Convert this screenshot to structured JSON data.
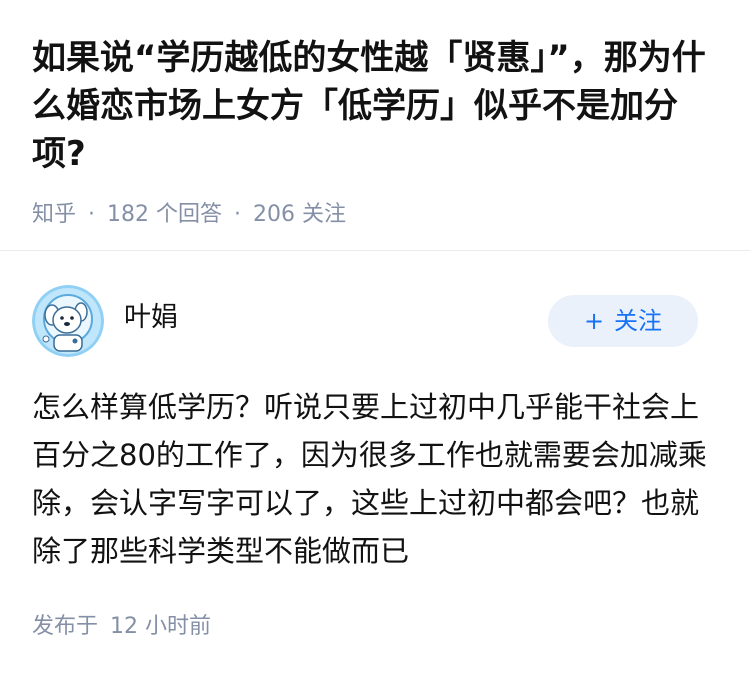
{
  "question": {
    "title": "如果说“学历越低的女性越「贤惠」”，那为什么婚恋市场上女方「低学历」似乎不是加分项?",
    "source": "知乎",
    "answer_count": "182 个回答",
    "follower_count": "206 关注",
    "separator": "·"
  },
  "author": {
    "name": "叶娟",
    "avatar_icon": "cartoon-dog-avatar-icon",
    "follow_label": "关注",
    "follow_icon": "+"
  },
  "answer": {
    "content": "怎么样算低学历？听说只要上过初中几乎能干社会上百分之80的工作了，因为很多工作也就需要会加减乘除，会认字写字可以了，这些上过初中都会吧？也就除了那些科学类型不能做而已",
    "published_label": "发布于",
    "published_time": "12 小时前"
  },
  "colors": {
    "text": "#121212",
    "meta": "#8590a6",
    "accent": "#1772f6",
    "follow_bg": "#eaf1fb",
    "divider": "#ebebeb"
  }
}
